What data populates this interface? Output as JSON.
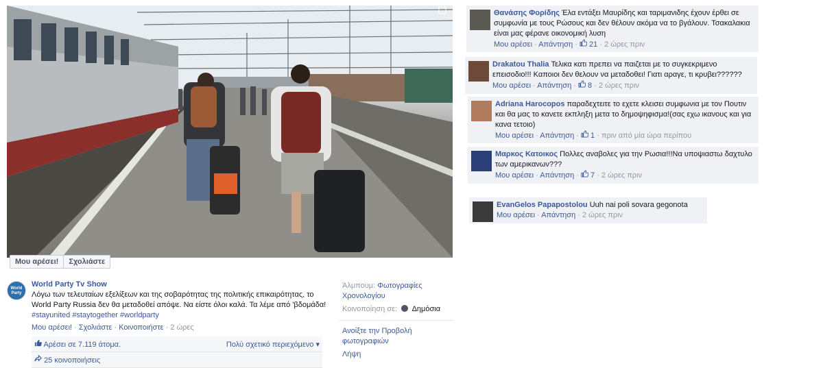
{
  "photo_actions": {
    "like": "Μου αρέσει!",
    "comment": "Σχολιάστε"
  },
  "post": {
    "avatar_text": "World Party",
    "author": "World Party Tv Show",
    "text": "Λόγω των τελευταίων εξελίξεων και της σοβαρότητας της πολιτικής επικαιρότητας, το World Party Russia δεν θα μεταδοθεί απόψε. Να είστε όλοι καλά. Τα λέμε από 'βδομάδα!",
    "tags": "#stayunited #staytogether #worldparty",
    "like": "Μου αρέσει!",
    "comment": "Σχολιάστε",
    "share": "Κοινοποιήστε",
    "time": "2 ώρες",
    "likes_text": "Αρέσει σε 7.119 άτομα.",
    "sort_text": "Πολύ σχετικό περιεχόμενο ▾",
    "shares_text": "25 κοινοποιήσεις"
  },
  "side": {
    "album_label": "Άλμπουμ:",
    "album_name": "Φωτογραφίες Χρονολογίου",
    "shared_with_label": "Κοινοποίηση σε:",
    "shared_with_value": "Δημόσια",
    "open_viewer": "Ανοίξτε την Προβολή φωτογραφιών",
    "download": "Λήψη"
  },
  "comments": [
    {
      "name": "Θανάσης Φορίδης",
      "text": "Έλα εντάξει Μαυρίδης και ταριμανιδης έχουν έρθει σε συμφωνία με τους Ρώσους και δεν θέλουν ακόμα να το βγάλουν. Τσακαλακια είναι μας φέρανε οικονομική λυση",
      "like": "Μου αρέσει",
      "reply": "Απάντηση",
      "likes": "21",
      "time": "2 ώρες πριν",
      "avatar_color": "#5b5a52"
    },
    {
      "name": "Drakatou Thalia",
      "text": "Τελικα κατι πρεπει να παιζεται με το συγκεκριμενο επεισοδιο!!! Καποιοι δεν θελουν να μεταδοθει! Γιατι αραγε, τι κρυβει??????",
      "like": "Μου αρέσει",
      "reply": "Απάντηση",
      "likes": "8",
      "time": "2 ώρες πριν",
      "avatar_color": "#6e4a3a"
    },
    {
      "name": "Adriana Harocopos",
      "text": "παραδεχτειτε το εχετε κλεισει συμφωνια με τον Πουτιν και θα μας το κανετε εκπληξη μετα το δημοψηφισμα!(σας εχω ικανους και για κανα τετοιο)",
      "like": "Μου αρέσει",
      "reply": "Απάντηση",
      "likes": "1",
      "time": "πριν από μία ώρα περίπου",
      "avatar_color": "#b07a5c"
    },
    {
      "name": "Μαρκος Κατοικος",
      "text": "Πολλες αναβολες για την Ρωσια!!!Να υποψιαστω δαχτυλο των αμερικανων???",
      "like": "Μου αρέσει",
      "reply": "Απάντηση",
      "likes": "7",
      "time": "2 ώρες πριν",
      "avatar_color": "#2b3f78"
    },
    {
      "name": "EvanGelos Papapostolou",
      "text": "Uuh nai poli sovara gegonota",
      "like": "Μου αρέσει",
      "reply": "Απάντηση",
      "likes": "",
      "time": "2 ώρες πριν",
      "avatar_color": "#3a3a3a"
    }
  ]
}
